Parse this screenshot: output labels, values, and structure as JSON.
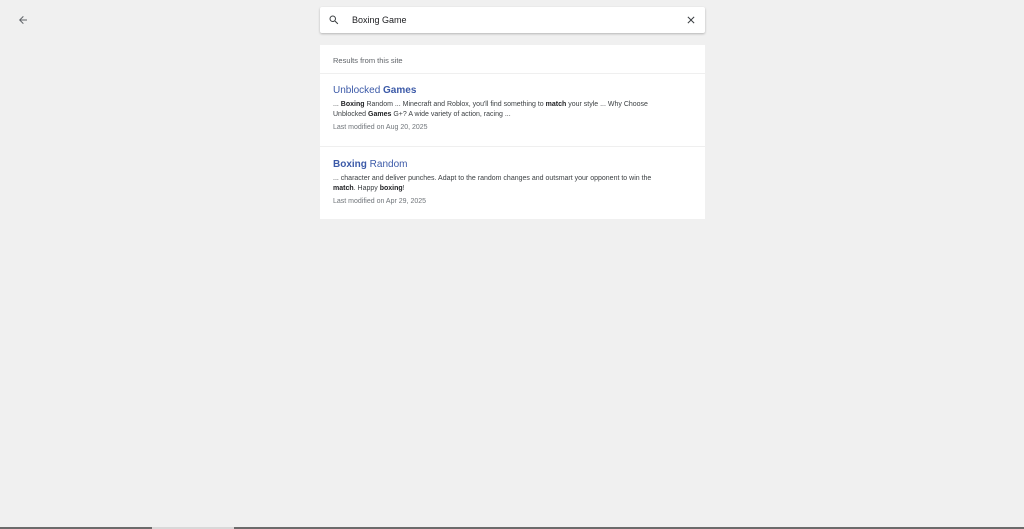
{
  "header": {
    "back_icon": "arrow-left-icon"
  },
  "search": {
    "icon": "search-icon",
    "value": "Boxing Game",
    "clear_icon": "close-icon"
  },
  "results": {
    "header": "Results from this site",
    "items": [
      {
        "title_parts": [
          {
            "text": "Unblocked ",
            "bold": false
          },
          {
            "text": "Games",
            "bold": true
          }
        ],
        "snippet_line1_parts": [
          {
            "text": "... ",
            "bold": false
          },
          {
            "text": "Boxing",
            "bold": true
          },
          {
            "text": " Random ... Minecraft and Roblox, you'll find something to ",
            "bold": false
          },
          {
            "text": "match",
            "bold": true
          },
          {
            "text": " your style ... Why Choose",
            "bold": false
          }
        ],
        "snippet_line2_parts": [
          {
            "text": "Unblocked ",
            "bold": false
          },
          {
            "text": "Games",
            "bold": true
          },
          {
            "text": " G+? A wide variety of action, racing ...",
            "bold": false
          }
        ],
        "modified": "Last modified on Aug 20, 2025"
      },
      {
        "title_parts": [
          {
            "text": "Boxing",
            "bold": true
          },
          {
            "text": " Random",
            "bold": false
          }
        ],
        "snippet_line1_parts": [
          {
            "text": "... character and deliver punches. Adapt to the random changes and outsmart your opponent to win the",
            "bold": false
          }
        ],
        "snippet_line2_parts": [
          {
            "text": "match",
            "bold": true
          },
          {
            "text": ". Happy ",
            "bold": false
          },
          {
            "text": "boxing",
            "bold": true
          },
          {
            "text": "!",
            "bold": false
          }
        ],
        "modified": "Last modified on Apr 29, 2025"
      }
    ]
  },
  "colors": {
    "background": "#f0f0f0",
    "link": "#3c5aa8",
    "panel": "#ffffff"
  }
}
